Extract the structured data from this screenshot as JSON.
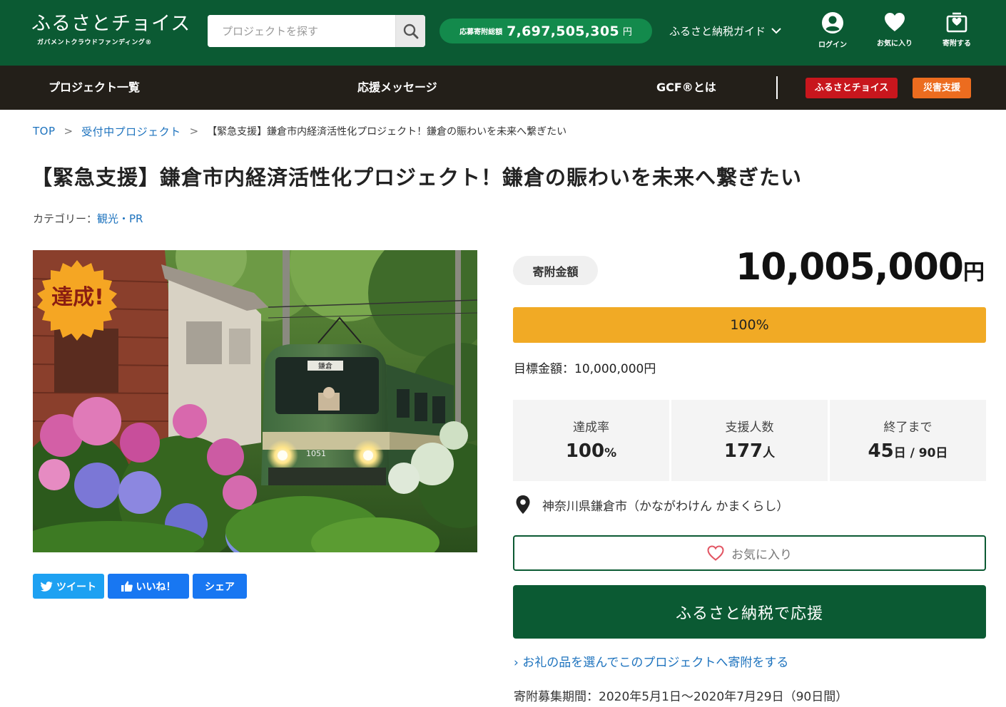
{
  "header": {
    "logo_main": "ふるさとチョイス",
    "logo_sub": "ガバメントクラウドファンディング®",
    "search_placeholder": "プロジェクトを探す",
    "total_label": "応募寄附総額",
    "total_value": "7,697,505,305",
    "total_unit": "円",
    "guide_label": "ふるさと納税ガイド",
    "icons": {
      "login": "ログイン",
      "favorites": "お気に入り",
      "donate": "寄附する"
    }
  },
  "nav": {
    "items": [
      "プロジェクト一覧",
      "応援メッセージ",
      "GCF®とは"
    ],
    "badges": [
      {
        "label": "ふるさとチョイス",
        "color": "#c8161d"
      },
      {
        "label": "災害支援",
        "color": "#ec6c1f"
      }
    ]
  },
  "breadcrumb": {
    "top": "TOP",
    "accepting": "受付中プロジェクト",
    "current": "【緊急支援】鎌倉市内経済活性化プロジェクト！鎌倉の賑わいを未来へ繋ぎたい",
    "sep": ">"
  },
  "project": {
    "title": "【緊急支援】鎌倉市内経済活性化プロジェクト！鎌倉の賑わいを未来へ繋ぎたい",
    "category_label": "カテゴリー：",
    "category_value": "観光・PR",
    "badge": "達成!",
    "train_sign": "鎌倉",
    "train_number": "1051"
  },
  "share": {
    "tweet": "ツイート",
    "like": "いいね！",
    "share": "シェア"
  },
  "funding": {
    "amount_label": "寄附金額",
    "amount_value": "10,005,000",
    "amount_unit": "円",
    "progress": 1.0,
    "progress_text": "100%",
    "goal": "目標金額：10,000,000円",
    "stats": [
      {
        "label": "達成率",
        "value": "100",
        "unit": "%"
      },
      {
        "label": "支援人数",
        "value": "177",
        "unit": "人"
      },
      {
        "label": "終了まで",
        "value": "45",
        "unit": "日 / 90日"
      }
    ],
    "location": "神奈川県鎌倉市（かながわけん かまくらし）",
    "favorite_label": "お気に入り",
    "support_label": "ふるさと納税で応援",
    "gift_link": "› お礼の品を選んでこのプロジェクトへ寄附をする",
    "period": "寄附募集期間：2020年5月1日〜2020年7月29日（90日間）"
  },
  "colors": {
    "header_green": "#0b5a33",
    "pill_green": "#138a4c",
    "nav_dark": "#231f19",
    "progress_orange": "#f1aa25",
    "link_blue": "#1e73be",
    "twitter_blue": "#1da1f2",
    "facebook_blue": "#1877f2"
  }
}
